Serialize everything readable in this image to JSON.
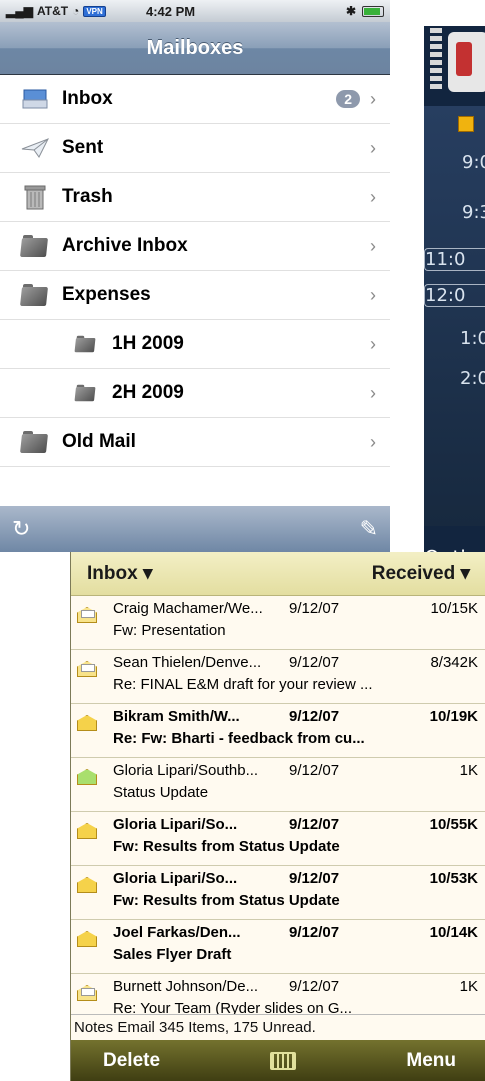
{
  "iphone": {
    "status": {
      "carrier": "AT&T",
      "vpn": "VPN",
      "time": "4:42 PM"
    },
    "title": "Mailboxes",
    "mailboxes": [
      {
        "label": "Inbox",
        "badge": "2",
        "icon": "inbox-tray-icon"
      },
      {
        "label": "Sent",
        "icon": "paper-plane-icon"
      },
      {
        "label": "Trash",
        "icon": "trash-can-icon"
      },
      {
        "label": "Archive Inbox",
        "icon": "folder-icon"
      },
      {
        "label": "Expenses",
        "icon": "folder-icon"
      },
      {
        "label": "1H 2009",
        "icon": "folder-icon",
        "sub": true
      },
      {
        "label": "2H 2009",
        "icon": "folder-icon",
        "sub": true
      },
      {
        "label": "Old Mail",
        "icon": "folder-icon"
      }
    ],
    "chevron": "›"
  },
  "nokia": {
    "times": [
      "9:0",
      "9:3",
      "11:0",
      "12:0",
      "1:0",
      "2:0"
    ],
    "softkey": "Optic"
  },
  "winmo": {
    "header": {
      "folder": "Inbox ▾",
      "sort": "Received ▾"
    },
    "messages": [
      {
        "from": "Craig Machamer/We...",
        "date": "9/12/07",
        "size": "10/15K",
        "subject": "Fw: Presentation",
        "unread": false,
        "icon": "open"
      },
      {
        "from": "Sean Thielen/Denve...",
        "date": "9/12/07",
        "size": "8/342K",
        "subject": "Re: FINAL E&M draft for your review ...",
        "unread": false,
        "icon": "open"
      },
      {
        "from": "Bikram Smith/W...",
        "date": "9/12/07",
        "size": "10/19K",
        "subject": "Re: Fw: Bharti - feedback from cu...",
        "unread": true,
        "icon": "closed"
      },
      {
        "from": "Gloria Lipari/Southb...",
        "date": "9/12/07",
        "size": "1K",
        "subject": "Status Update",
        "unread": false,
        "icon": "green"
      },
      {
        "from": "Gloria Lipari/So...",
        "date": "9/12/07",
        "size": "10/55K",
        "subject": "Fw: Results from  Status Update",
        "unread": true,
        "icon": "closed"
      },
      {
        "from": "Gloria Lipari/So...",
        "date": "9/12/07",
        "size": "10/53K",
        "subject": "Fw: Results from  Status Update",
        "unread": true,
        "icon": "closed"
      },
      {
        "from": "Joel Farkas/Den...",
        "date": "9/12/07",
        "size": "10/14K",
        "subject": "Sales Flyer Draft",
        "unread": true,
        "icon": "closed"
      },
      {
        "from": "Burnett Johnson/De...",
        "date": "9/12/07",
        "size": "1K",
        "subject": "Re: Your Team      (Ryder slides on G...",
        "unread": false,
        "icon": "open"
      }
    ],
    "status_text": "Notes Email  345 Items, 175 Unread.",
    "softkeys": {
      "left": "Delete",
      "right": "Menu"
    }
  }
}
